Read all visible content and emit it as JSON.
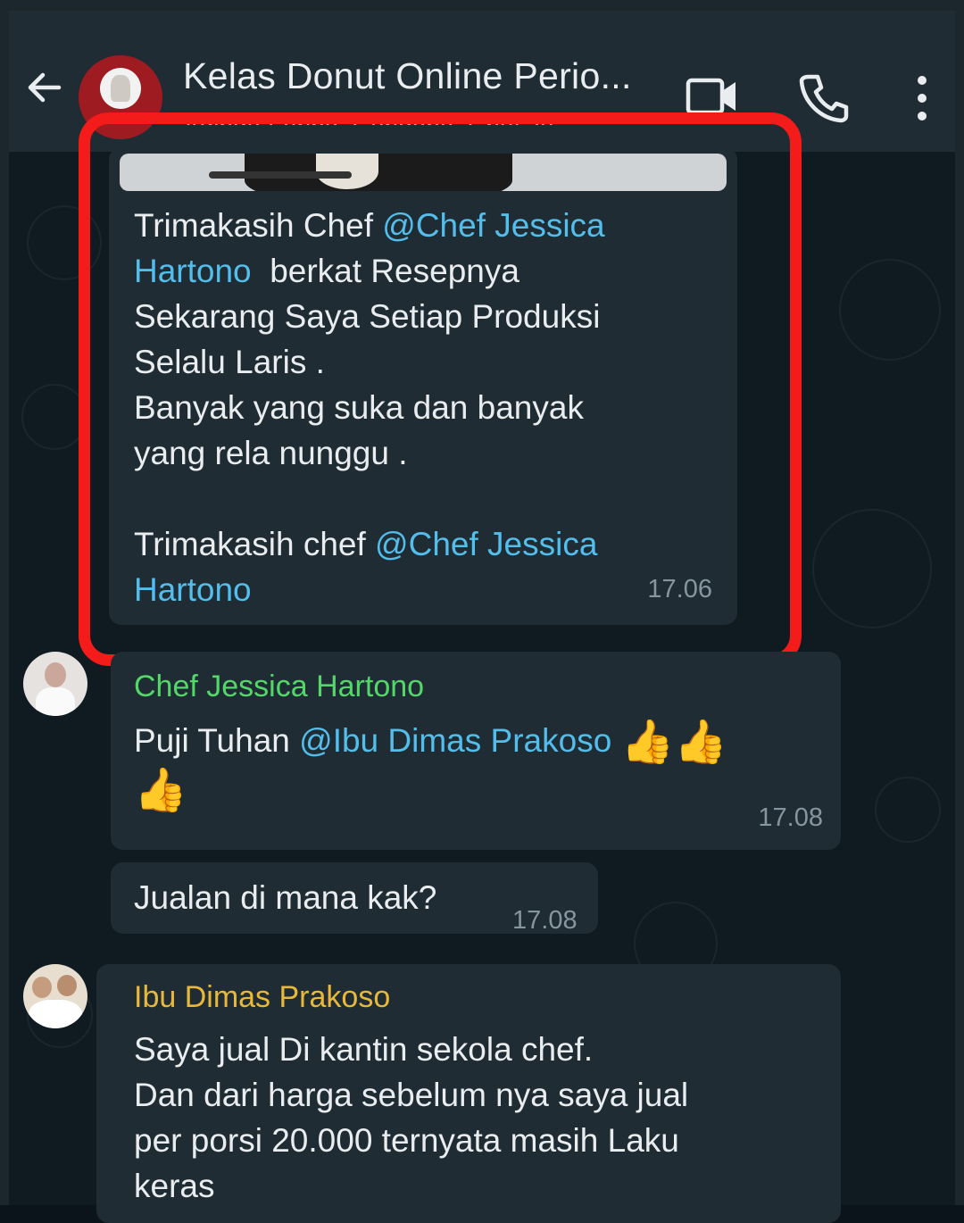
{
  "header": {
    "title": "Kelas Donut Online Perio...",
    "subtitle": "Adinda Farina, Cendana, Chef Je..."
  },
  "messages": [
    {
      "id": "m1",
      "lines": [
        {
          "text": "Trimakasih Chef "
        },
        {
          "mention": "@Chef Jessica"
        },
        {
          "text": "\n"
        },
        {
          "mention": "Hartono"
        },
        {
          "text": "  berkat Resepnya\nSekarang Saya Setiap Produksi\nSelalu Laris .\nBanyak yang suka dan banyak\nyang rela nunggu .\n\nTrimakasih chef "
        },
        {
          "mention": "@Chef Jessica"
        },
        {
          "text": "\n"
        },
        {
          "mention": "Hartono"
        }
      ],
      "time": "17.06"
    },
    {
      "id": "m2",
      "sender": "Chef Jessica Hartono",
      "text_before": "Puji Tuhan ",
      "mention": "@Ibu Dimas Prakoso",
      "emojis": [
        "👍",
        "👍",
        "👍"
      ],
      "time": "17.08"
    },
    {
      "id": "m3",
      "text": "Jualan di mana kak?",
      "time": "17.08"
    },
    {
      "id": "m4",
      "sender": "Ibu Dimas Prakoso",
      "text": "Saya jual Di kantin sekola chef.\nDan dari harga sebelum nya saya jual\nper porsi 20.000 ternyata masih Laku\nkeras"
    }
  ],
  "colors": {
    "mention": "#53bdeb",
    "sender_chef": "#53d769",
    "sender_ibu": "#e8b83a",
    "highlight": "#f41b1b",
    "bubble": "#202c33"
  },
  "icons": [
    "back-arrow-icon",
    "video-call-icon",
    "phone-icon",
    "more-options-icon",
    "thumbs-up-emoji"
  ]
}
